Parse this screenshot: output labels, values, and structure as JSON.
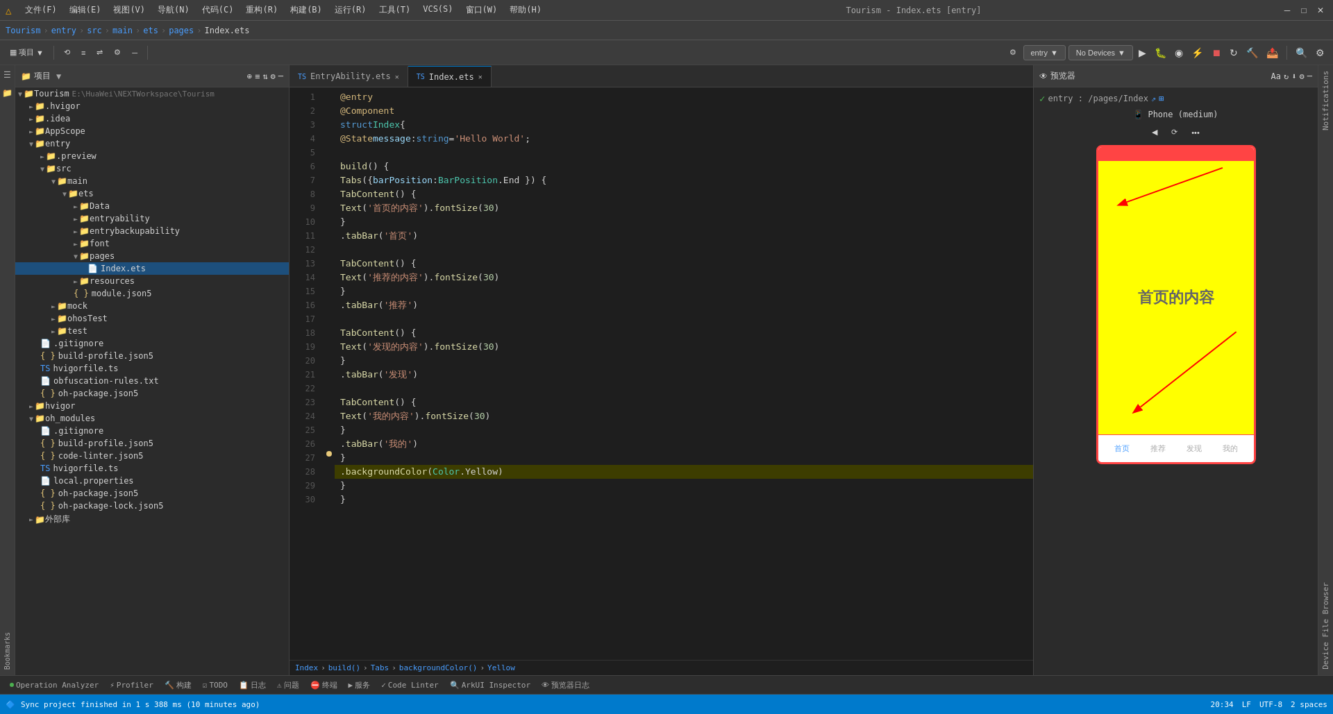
{
  "titleBar": {
    "icon": "△",
    "menus": [
      "文件(F)",
      "编辑(E)",
      "视图(V)",
      "导航(N)",
      "代码(C)",
      "重构(R)",
      "构建(B)",
      "运行(R)",
      "工具(T)",
      "VCS(S)",
      "窗口(W)",
      "帮助(H)"
    ],
    "title": "Tourism - Index.ets [entry]",
    "minimize": "─",
    "maximize": "□",
    "close": "✕"
  },
  "breadcrumb": {
    "items": [
      "Tourism",
      "entry",
      "src",
      "main",
      "ets",
      "pages",
      "Index.ets"
    ]
  },
  "toolbar": {
    "project_dropdown": "项目",
    "entry_dropdown": "entry",
    "no_devices": "No Devices",
    "run_icon": "▶",
    "settings_icon": "⚙",
    "search_icon": "🔍"
  },
  "sidebar": {
    "header": "项目",
    "tree": [
      {
        "level": 0,
        "type": "project",
        "name": "Tourism",
        "path": "E:\\HuaWei\\NEXTWorkspace\\Tourism",
        "expanded": true,
        "icon": "folder"
      },
      {
        "level": 1,
        "type": "folder",
        "name": ".hvigor",
        "expanded": false,
        "icon": "folder"
      },
      {
        "level": 1,
        "type": "folder",
        "name": ".idea",
        "expanded": false,
        "icon": "folder"
      },
      {
        "level": 1,
        "type": "folder",
        "name": "AppScope",
        "expanded": false,
        "icon": "folder"
      },
      {
        "level": 1,
        "type": "folder",
        "name": "entry",
        "expanded": true,
        "icon": "folder-orange"
      },
      {
        "level": 2,
        "type": "folder",
        "name": ".preview",
        "expanded": false,
        "icon": "folder"
      },
      {
        "level": 2,
        "type": "folder",
        "name": "src",
        "expanded": true,
        "icon": "folder"
      },
      {
        "level": 3,
        "type": "folder",
        "name": "main",
        "expanded": true,
        "icon": "folder"
      },
      {
        "level": 4,
        "type": "folder",
        "name": "ets",
        "expanded": true,
        "icon": "folder-blue"
      },
      {
        "level": 5,
        "type": "folder",
        "name": "Data",
        "expanded": false,
        "icon": "folder"
      },
      {
        "level": 5,
        "type": "folder",
        "name": "entryability",
        "expanded": false,
        "icon": "folder"
      },
      {
        "level": 5,
        "type": "folder",
        "name": "entrybackupability",
        "expanded": false,
        "icon": "folder"
      },
      {
        "level": 5,
        "type": "folder",
        "name": "font",
        "expanded": false,
        "icon": "folder"
      },
      {
        "level": 5,
        "type": "folder",
        "name": "pages",
        "expanded": true,
        "icon": "folder"
      },
      {
        "level": 6,
        "type": "file",
        "name": "Index.ets",
        "icon": "ets",
        "selected": true
      },
      {
        "level": 4,
        "type": "folder",
        "name": "resources",
        "expanded": false,
        "icon": "folder"
      },
      {
        "level": 4,
        "type": "file",
        "name": "module.json5",
        "icon": "json"
      },
      {
        "level": 3,
        "type": "folder",
        "name": "mock",
        "expanded": false,
        "icon": "folder"
      },
      {
        "level": 3,
        "type": "folder",
        "name": "ohosTest",
        "expanded": false,
        "icon": "folder"
      },
      {
        "level": 3,
        "type": "folder",
        "name": "test",
        "expanded": false,
        "icon": "folder"
      },
      {
        "level": 2,
        "type": "file",
        "name": ".gitignore",
        "icon": "file"
      },
      {
        "level": 2,
        "type": "file",
        "name": "build-profile.json5",
        "icon": "json"
      },
      {
        "level": 2,
        "type": "file",
        "name": "hvigorfile.ts",
        "icon": "ts"
      },
      {
        "level": 2,
        "type": "file",
        "name": "obfuscation-rules.txt",
        "icon": "txt"
      },
      {
        "level": 2,
        "type": "file",
        "name": "oh-package.json5",
        "icon": "json"
      },
      {
        "level": 1,
        "type": "folder",
        "name": "hvigor",
        "expanded": false,
        "icon": "folder"
      },
      {
        "level": 1,
        "type": "folder",
        "name": "oh_modules",
        "expanded": false,
        "icon": "folder-orange"
      },
      {
        "level": 2,
        "type": "file",
        "name": ".gitignore",
        "icon": "file"
      },
      {
        "level": 2,
        "type": "file",
        "name": "build-profile.json5",
        "icon": "json"
      },
      {
        "level": 2,
        "type": "file",
        "name": "code-linter.json5",
        "icon": "json"
      },
      {
        "level": 2,
        "type": "file",
        "name": "hvigorfile.ts",
        "icon": "ts"
      },
      {
        "level": 2,
        "type": "file",
        "name": "local.properties",
        "icon": "properties"
      },
      {
        "level": 2,
        "type": "file",
        "name": "oh-package.json5",
        "icon": "json"
      },
      {
        "level": 2,
        "type": "file",
        "name": "oh-package-lock.json5",
        "icon": "json"
      },
      {
        "level": 1,
        "type": "folder",
        "name": "外部库",
        "expanded": false,
        "icon": "folder"
      }
    ]
  },
  "editorTabs": [
    {
      "name": "EntryAbility.ets",
      "active": false,
      "modified": false
    },
    {
      "name": "Index.ets",
      "active": true,
      "modified": false
    }
  ],
  "codeLines": [
    {
      "num": 1,
      "content": "@entry",
      "type": "decorator"
    },
    {
      "num": 2,
      "content": "@Component",
      "type": "decorator"
    },
    {
      "num": 3,
      "content": "struct Index {",
      "parts": [
        {
          "text": "struct ",
          "cls": "kw"
        },
        {
          "text": "Index",
          "cls": "type"
        },
        {
          "text": " {",
          "cls": "plain"
        }
      ]
    },
    {
      "num": 4,
      "content": "  @State message: string = 'Hello World';",
      "parts": [
        {
          "text": "  "
        },
        {
          "text": "@State ",
          "cls": "decorator"
        },
        {
          "text": "message",
          "cls": "identifier"
        },
        {
          "text": ": ",
          "cls": "plain"
        },
        {
          "text": "string",
          "cls": "kw"
        },
        {
          "text": " = ",
          "cls": "plain"
        },
        {
          "text": "'Hello World'",
          "cls": "string"
        },
        {
          "text": ";",
          "cls": "plain"
        }
      ]
    },
    {
      "num": 5,
      "content": ""
    },
    {
      "num": 6,
      "content": "  build() {",
      "parts": [
        {
          "text": "  "
        },
        {
          "text": "build",
          "cls": "fn"
        },
        {
          "text": "() {",
          "cls": "plain"
        }
      ]
    },
    {
      "num": 7,
      "content": "    Tabs({ barPosition: BarPosition.End }) {",
      "parts": [
        {
          "text": "    "
        },
        {
          "text": "Tabs",
          "cls": "fn"
        },
        {
          "text": "({ ",
          "cls": "plain"
        },
        {
          "text": "barPosition",
          "cls": "param"
        },
        {
          "text": ": ",
          "cls": "plain"
        },
        {
          "text": "BarPosition",
          "cls": "type"
        },
        {
          "text": ".End }) {",
          "cls": "plain"
        }
      ]
    },
    {
      "num": 8,
      "content": "      TabContent() {",
      "parts": [
        {
          "text": "      "
        },
        {
          "text": "TabContent",
          "cls": "fn"
        },
        {
          "text": "() {",
          "cls": "plain"
        }
      ]
    },
    {
      "num": 9,
      "content": "        Text('首页的内容').fontSize(30)",
      "parts": [
        {
          "text": "        "
        },
        {
          "text": "Text",
          "cls": "fn"
        },
        {
          "text": "(",
          "cls": "plain"
        },
        {
          "text": "'首页的内容'",
          "cls": "string"
        },
        {
          "text": ").",
          "cls": "plain"
        },
        {
          "text": "fontSize",
          "cls": "method"
        },
        {
          "text": "(",
          "cls": "plain"
        },
        {
          "text": "30",
          "cls": "number"
        },
        {
          "text": ")",
          "cls": "plain"
        }
      ]
    },
    {
      "num": 10,
      "content": "      }"
    },
    {
      "num": 11,
      "content": "      .tabBar('首页')",
      "parts": [
        {
          "text": "      "
        },
        {
          "text": ".tabBar",
          "cls": "method"
        },
        {
          "text": "(",
          "cls": "plain"
        },
        {
          "text": "'首页'",
          "cls": "string"
        },
        {
          "text": ")",
          "cls": "plain"
        }
      ]
    },
    {
      "num": 12,
      "content": ""
    },
    {
      "num": 13,
      "content": "      TabContent() {",
      "parts": [
        {
          "text": "      "
        },
        {
          "text": "TabContent",
          "cls": "fn"
        },
        {
          "text": "() {",
          "cls": "plain"
        }
      ]
    },
    {
      "num": 14,
      "content": "        Text('推荐的内容').fontSize(30)",
      "parts": [
        {
          "text": "        "
        },
        {
          "text": "Text",
          "cls": "fn"
        },
        {
          "text": "(",
          "cls": "plain"
        },
        {
          "text": "'推荐的内容'",
          "cls": "string"
        },
        {
          "text": ").",
          "cls": "plain"
        },
        {
          "text": "fontSize",
          "cls": "method"
        },
        {
          "text": "(",
          "cls": "plain"
        },
        {
          "text": "30",
          "cls": "number"
        },
        {
          "text": ")",
          "cls": "plain"
        }
      ]
    },
    {
      "num": 15,
      "content": "      }"
    },
    {
      "num": 16,
      "content": "      .tabBar('推荐')",
      "parts": [
        {
          "text": "      "
        },
        {
          "text": ".tabBar",
          "cls": "method"
        },
        {
          "text": "(",
          "cls": "plain"
        },
        {
          "text": "'推荐'",
          "cls": "string"
        },
        {
          "text": ")",
          "cls": "plain"
        }
      ]
    },
    {
      "num": 17,
      "content": ""
    },
    {
      "num": 18,
      "content": "      TabContent() {",
      "parts": [
        {
          "text": "      "
        },
        {
          "text": "TabContent",
          "cls": "fn"
        },
        {
          "text": "() {",
          "cls": "plain"
        }
      ]
    },
    {
      "num": 19,
      "content": "        Text('发现的内容').fontSize(30)",
      "parts": [
        {
          "text": "        "
        },
        {
          "text": "Text",
          "cls": "fn"
        },
        {
          "text": "(",
          "cls": "plain"
        },
        {
          "text": "'发现的内容'",
          "cls": "string"
        },
        {
          "text": ").",
          "cls": "plain"
        },
        {
          "text": "fontSize",
          "cls": "method"
        },
        {
          "text": "(",
          "cls": "plain"
        },
        {
          "text": "30",
          "cls": "number"
        },
        {
          "text": ")",
          "cls": "plain"
        }
      ]
    },
    {
      "num": 20,
      "content": "      }"
    },
    {
      "num": 21,
      "content": "      .tabBar('发现')",
      "parts": [
        {
          "text": "      "
        },
        {
          "text": ".tabBar",
          "cls": "method"
        },
        {
          "text": "(",
          "cls": "plain"
        },
        {
          "text": "'发现'",
          "cls": "string"
        },
        {
          "text": ")",
          "cls": "plain"
        }
      ]
    },
    {
      "num": 22,
      "content": ""
    },
    {
      "num": 23,
      "content": "      TabContent() {",
      "parts": [
        {
          "text": "      "
        },
        {
          "text": "TabContent",
          "cls": "fn"
        },
        {
          "text": "() {",
          "cls": "plain"
        }
      ]
    },
    {
      "num": 24,
      "content": "        Text('我的内容').fontSize(30)",
      "parts": [
        {
          "text": "        "
        },
        {
          "text": "Text",
          "cls": "fn"
        },
        {
          "text": "(",
          "cls": "plain"
        },
        {
          "text": "'我的内容'",
          "cls": "string"
        },
        {
          "text": ").",
          "cls": "plain"
        },
        {
          "text": "fontSize",
          "cls": "method"
        },
        {
          "text": "(",
          "cls": "plain"
        },
        {
          "text": "30",
          "cls": "number"
        },
        {
          "text": ")",
          "cls": "plain"
        }
      ]
    },
    {
      "num": 25,
      "content": "      }"
    },
    {
      "num": 26,
      "content": "      .tabBar('我的')",
      "parts": [
        {
          "text": "      "
        },
        {
          "text": ".tabBar",
          "cls": "method"
        },
        {
          "text": "(",
          "cls": "plain"
        },
        {
          "text": "'我的'",
          "cls": "string"
        },
        {
          "text": ")",
          "cls": "plain"
        }
      ]
    },
    {
      "num": 27,
      "content": "    }"
    },
    {
      "num": 28,
      "content": "    .backgroundColor(Color.Yellow)",
      "highlighted": true,
      "parts": [
        {
          "text": "    "
        },
        {
          "text": ".backgroundColor",
          "cls": "method"
        },
        {
          "text": "(",
          "cls": "plain"
        },
        {
          "text": "Color",
          "cls": "type"
        },
        {
          "text": ".Yellow)",
          "cls": "plain"
        }
      ]
    },
    {
      "num": 29,
      "content": "  }"
    },
    {
      "num": 30,
      "content": "}"
    }
  ],
  "preview": {
    "header": "预览器",
    "breadcrumb": "entry : /pages/Index",
    "device_label": "Phone (medium)",
    "back_btn": "◀",
    "rotate_btn": "⟳",
    "more_btn": "•••",
    "phone_content": "首页的内容",
    "tab_items": [
      "首页",
      "推荐",
      "发现",
      "我的"
    ]
  },
  "bottomTabs": [
    {
      "name": "Index",
      "type": "nav"
    },
    {
      "name": "build()",
      "type": "nav"
    },
    {
      "name": "Tabs",
      "type": "nav"
    },
    {
      "name": "backgroundColor()",
      "type": "nav"
    },
    {
      "name": "Yellow",
      "type": "nav"
    }
  ],
  "bottomBar": {
    "tabs": [
      {
        "icon": "●",
        "color": "#4CAF50",
        "label": "Operation Analyzer"
      },
      {
        "icon": "⚡",
        "color": "#aaa",
        "label": "Profiler"
      },
      {
        "icon": "🔨",
        "color": "#aaa",
        "label": "构建"
      },
      {
        "icon": "☑",
        "color": "#aaa",
        "label": "TODO"
      },
      {
        "icon": "📋",
        "color": "#aaa",
        "label": "日志"
      },
      {
        "icon": "⚠",
        "color": "#aaa",
        "label": "问题"
      },
      {
        "icon": "⛔",
        "color": "#aaa",
        "label": "终端"
      },
      {
        "icon": "▶",
        "color": "#aaa",
        "label": "服务"
      },
      {
        "icon": "✓",
        "color": "#aaa",
        "label": "Code Linter"
      },
      {
        "icon": "🔍",
        "color": "#aaa",
        "label": "ArkUI Inspector"
      },
      {
        "icon": "👁",
        "color": "#aaa",
        "label": "预览器日志"
      }
    ]
  },
  "statusBar": {
    "sync_message": "Sync project finished in 1 s 388 ms (10 minutes ago)",
    "time": "20:34",
    "encoding": "LF",
    "charset": "UTF-8",
    "indent": "2 spaces"
  },
  "verticalPanels": {
    "right": [
      "Notifications",
      "Device File Browser"
    ]
  }
}
